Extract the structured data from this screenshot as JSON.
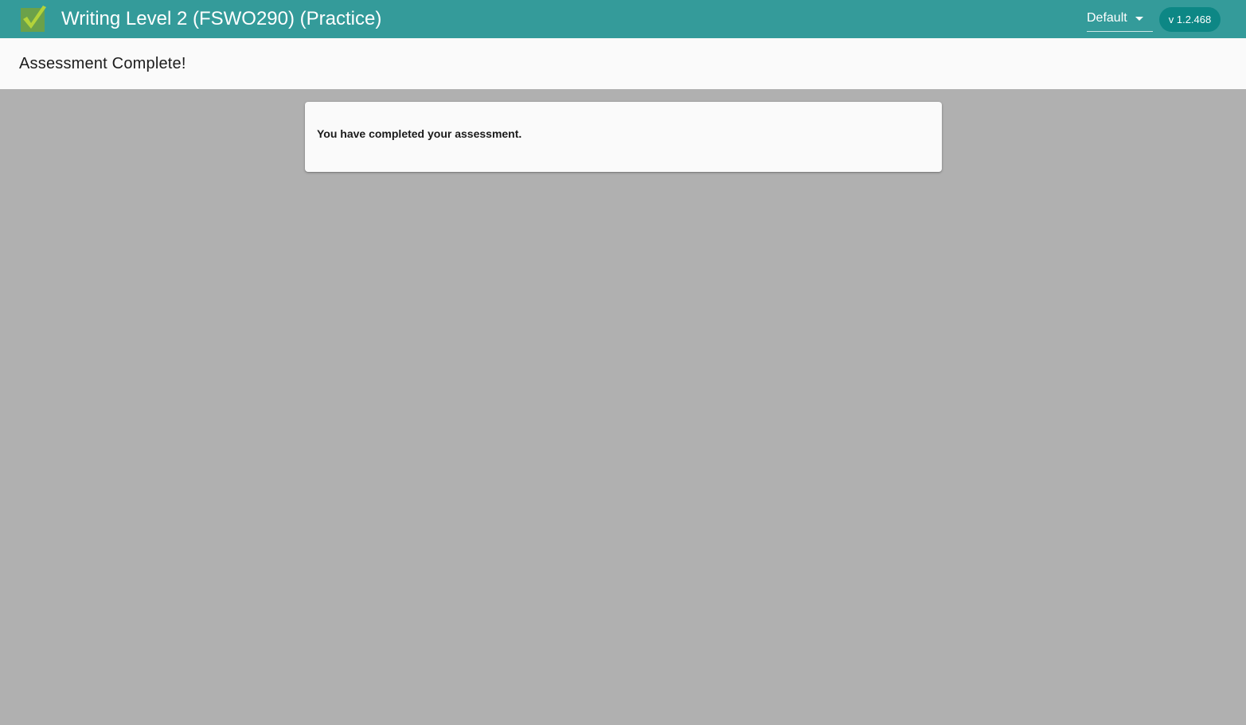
{
  "header": {
    "logo_icon": "checkmark-box-logo-icon",
    "title": "Writing Level 2 (FSWO290) (Practice)",
    "theme_select": {
      "selected": "Default",
      "icon": "chevron-down-icon"
    },
    "version": "v 1.2.468",
    "colors": {
      "bar": "#349b9a",
      "badge": "#0d8785"
    }
  },
  "subheader": {
    "title": "Assessment Complete!"
  },
  "main": {
    "message": "You have completed your assessment.",
    "background": "#b0b0b0"
  }
}
